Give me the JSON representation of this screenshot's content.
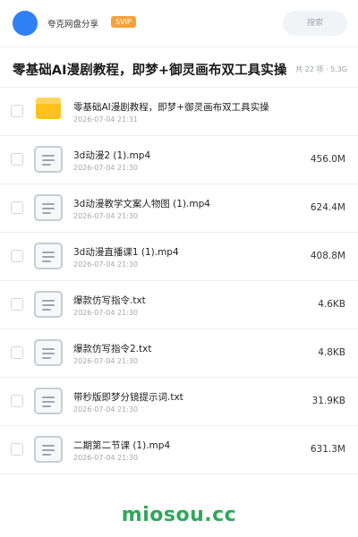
{
  "header": {
    "app_title": "夸克网盘分享",
    "badge": "SVIP",
    "search_placeholder": "搜索",
    "accent": "#2f80f5"
  },
  "share": {
    "title": "零基础AI漫剧教程，即梦+御灵画布双工具实操",
    "summary": "共 22 项 · 5.3G"
  },
  "files": [
    {
      "name": "零基础AI漫剧教程，即梦+御灵画布双工具实操",
      "date": "2026-07-04 21:31",
      "size": "",
      "type": "folder-icon"
    },
    {
      "name": "3d动漫2 (1).mp4",
      "date": "2026-07-04 21:30",
      "size": "456.0M",
      "type": "file-icon"
    },
    {
      "name": "3d动漫教学文案人物图 (1).mp4",
      "date": "2026-07-04 21:30",
      "size": "624.4M",
      "type": "file-icon"
    },
    {
      "name": "3d动漫直播课1 (1).mp4",
      "date": "2026-07-04 21:30",
      "size": "408.8M",
      "type": "file-icon"
    },
    {
      "name": "爆款仿写指令.txt",
      "date": "2026-07-04 21:30",
      "size": "4.6KB",
      "type": "file-icon"
    },
    {
      "name": "爆款仿写指令2.txt",
      "date": "2026-07-04 21:30",
      "size": "4.8KB",
      "type": "file-icon"
    },
    {
      "name": "带秒版即梦分镜提示词.txt",
      "date": "2026-07-04 21:30",
      "size": "31.9KB",
      "type": "file-icon"
    },
    {
      "name": "二期第二节课 (1).mp4",
      "date": "2026-07-04 21:30",
      "size": "631.3M",
      "type": "file-icon"
    }
  ],
  "watermark": "miosou.cc"
}
